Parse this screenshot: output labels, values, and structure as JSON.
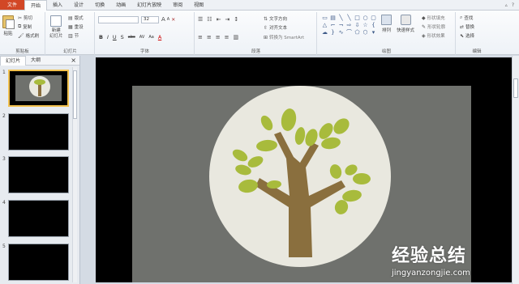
{
  "tabs": [
    "文件",
    "开始",
    "插入",
    "设计",
    "切换",
    "动画",
    "幻灯片放映",
    "审阅",
    "视图"
  ],
  "ribbon": {
    "clipboard": {
      "paste": "粘贴",
      "cut": "剪切",
      "copy": "复制",
      "format_painter": "格式刷",
      "label": "剪贴板"
    },
    "slides": {
      "new_slide": "新建\n幻灯片",
      "layout": "版式",
      "reset": "重设",
      "section": "节",
      "label": "幻灯片"
    },
    "font": {
      "font_size": "32",
      "label": "字体",
      "format_buttons": [
        "B",
        "I",
        "U",
        "S",
        "abc",
        "AV",
        "Aa",
        "A"
      ]
    },
    "paragraph": {
      "text_direction": "文字方向",
      "align_text": "对齐文本",
      "smartart": "转换为 SmartArt",
      "label": "段落"
    },
    "drawing": {
      "arrange": "排列",
      "quick_styles": "快速样式",
      "shape_fill": "形状填充",
      "shape_outline": "形状轮廓",
      "shape_effects": "形状效果",
      "label": "绘图"
    },
    "editing": {
      "find": "查找",
      "replace": "替换",
      "select": "选择",
      "label": "编辑"
    }
  },
  "pane_tabs": [
    "幻灯片",
    "大纲"
  ],
  "slides": [
    "1",
    "2",
    "3",
    "4",
    "5"
  ],
  "watermark": {
    "cn": "经验总结",
    "url": "jingyanzongjie.com"
  },
  "colors": {
    "file_tab": "#d24726",
    "selected_thumb": "#f2c14e",
    "slide_bg": "#6f716d",
    "circle": "#e9e8df",
    "trunk": "#8a6f3e",
    "leaf": "#a8bb3c"
  }
}
